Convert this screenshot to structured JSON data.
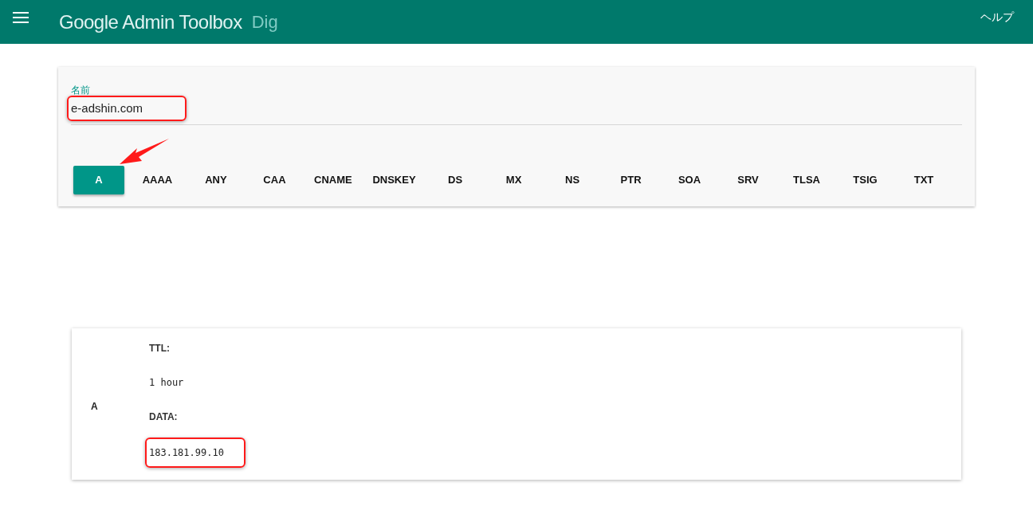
{
  "header": {
    "title": "Google Admin Toolbox",
    "subtitle": "Dig",
    "help": "ヘルプ"
  },
  "search": {
    "label": "名前",
    "value": "e-adshin.com",
    "highlighted": true
  },
  "record_types": [
    {
      "label": "A",
      "selected": true
    },
    {
      "label": "AAAA",
      "selected": false
    },
    {
      "label": "ANY",
      "selected": false
    },
    {
      "label": "CAA",
      "selected": false
    },
    {
      "label": "CNAME",
      "selected": false
    },
    {
      "label": "DNSKEY",
      "selected": false
    },
    {
      "label": "DS",
      "selected": false
    },
    {
      "label": "MX",
      "selected": false
    },
    {
      "label": "NS",
      "selected": false
    },
    {
      "label": "PTR",
      "selected": false
    },
    {
      "label": "SOA",
      "selected": false
    },
    {
      "label": "SRV",
      "selected": false
    },
    {
      "label": "TLSA",
      "selected": false
    },
    {
      "label": "TSIG",
      "selected": false
    },
    {
      "label": "TXT",
      "selected": false
    }
  ],
  "result": {
    "type": "A",
    "fields": [
      {
        "label": "TTL:",
        "value": "1 hour",
        "highlighted": false
      },
      {
        "label": "DATA:",
        "value": "183.181.99.10",
        "highlighted": true
      }
    ]
  }
}
